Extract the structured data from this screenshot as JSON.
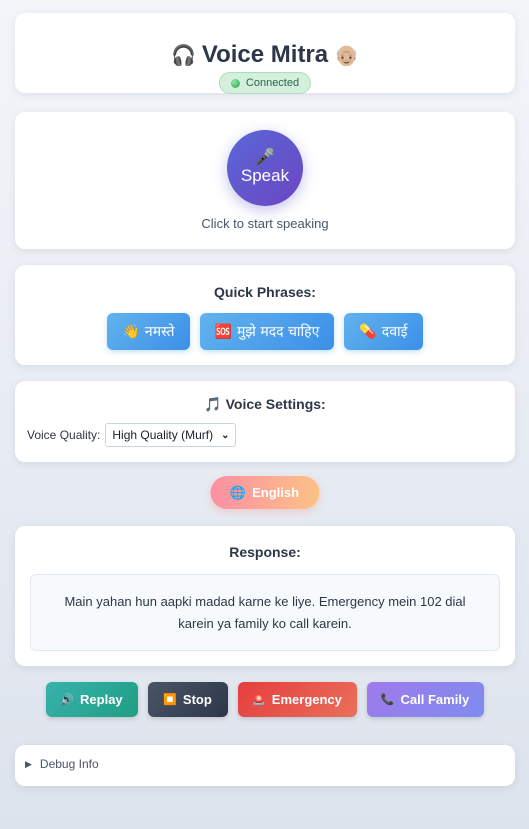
{
  "header": {
    "title": "Voice Mitra",
    "left_emoji": "🎧",
    "right_emoji": "👴🏼",
    "status": "Connected"
  },
  "speak": {
    "mic_emoji": "🎤",
    "label": "Speak",
    "hint": "Click to start speaking"
  },
  "quick_phrases": {
    "title": "Quick Phrases:",
    "items": [
      {
        "emoji": "👋",
        "label": "नमस्ते"
      },
      {
        "emoji": "🆘",
        "label": "मुझे मदद चाहिए"
      },
      {
        "emoji": "💊",
        "label": "दवाई"
      }
    ]
  },
  "voice_settings": {
    "emoji": "🎵",
    "title": "Voice Settings:",
    "quality_label": "Voice Quality:",
    "quality_value": "High Quality (Murf)"
  },
  "language": {
    "emoji": "🌐",
    "label": "English"
  },
  "response": {
    "title": "Response:",
    "text": "Main yahan hun aapki madad karne ke liye. Emergency mein 102 dial karein ya family ko call karein."
  },
  "actions": {
    "replay": {
      "emoji": "🔊",
      "label": "Replay"
    },
    "stop": {
      "emoji": "⏹️",
      "label": "Stop"
    },
    "emergency": {
      "emoji": "🚨",
      "label": "Emergency"
    },
    "call_family": {
      "emoji": "📞",
      "label": "Call Family"
    }
  },
  "debug": {
    "label": "Debug Info"
  },
  "colors": {
    "accent": "#5a67d8",
    "status_green": "#2f9e4f",
    "phrase_blue": "#4299e1"
  }
}
